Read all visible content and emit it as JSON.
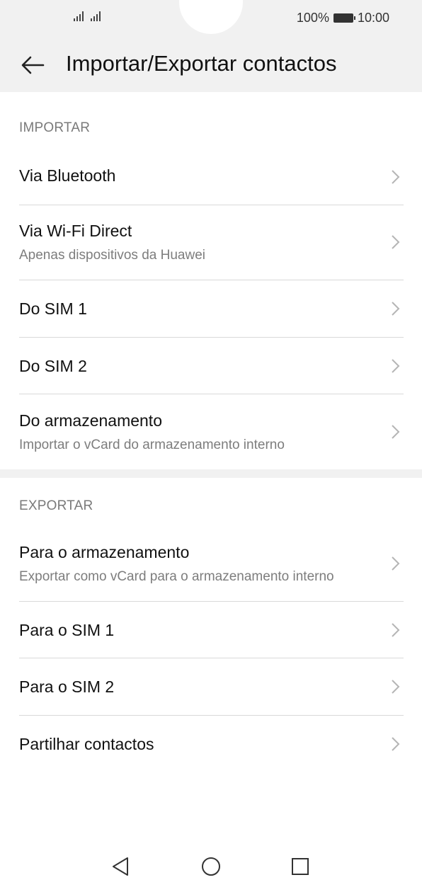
{
  "status_bar": {
    "battery": "100%",
    "time": "10:00",
    "signal_icons": [
      "signal-sim1-icon",
      "signal-sim2-icon"
    ]
  },
  "header": {
    "title": "Importar/Exportar contactos",
    "back_icon": "arrow-left-icon"
  },
  "import_section": {
    "label": "IMPORTAR",
    "items": [
      {
        "title": "Via Bluetooth",
        "subtitle": ""
      },
      {
        "title": "Via Wi-Fi Direct",
        "subtitle": "Apenas dispositivos da Huawei"
      },
      {
        "title": "Do SIM 1",
        "subtitle": ""
      },
      {
        "title": "Do SIM 2",
        "subtitle": ""
      },
      {
        "title": "Do armazenamento",
        "subtitle": "Importar o vCard do armazenamento interno"
      }
    ]
  },
  "export_section": {
    "label": "EXPORTAR",
    "items": [
      {
        "title": "Para o armazenamento",
        "subtitle": "Exportar como vCard para o armazenamento interno"
      },
      {
        "title": "Para o SIM 1",
        "subtitle": ""
      },
      {
        "title": "Para o SIM 2",
        "subtitle": ""
      },
      {
        "title": "Partilhar contactos",
        "subtitle": ""
      }
    ]
  },
  "nav_bar": {
    "icons": [
      "back-triangle-icon",
      "home-circle-icon",
      "recents-square-icon"
    ]
  },
  "colors": {
    "header_bg": "#f1f1f1",
    "section_label": "#7a7a7a",
    "subtitle": "#7d7d7d",
    "divider": "#d9d9d9"
  }
}
